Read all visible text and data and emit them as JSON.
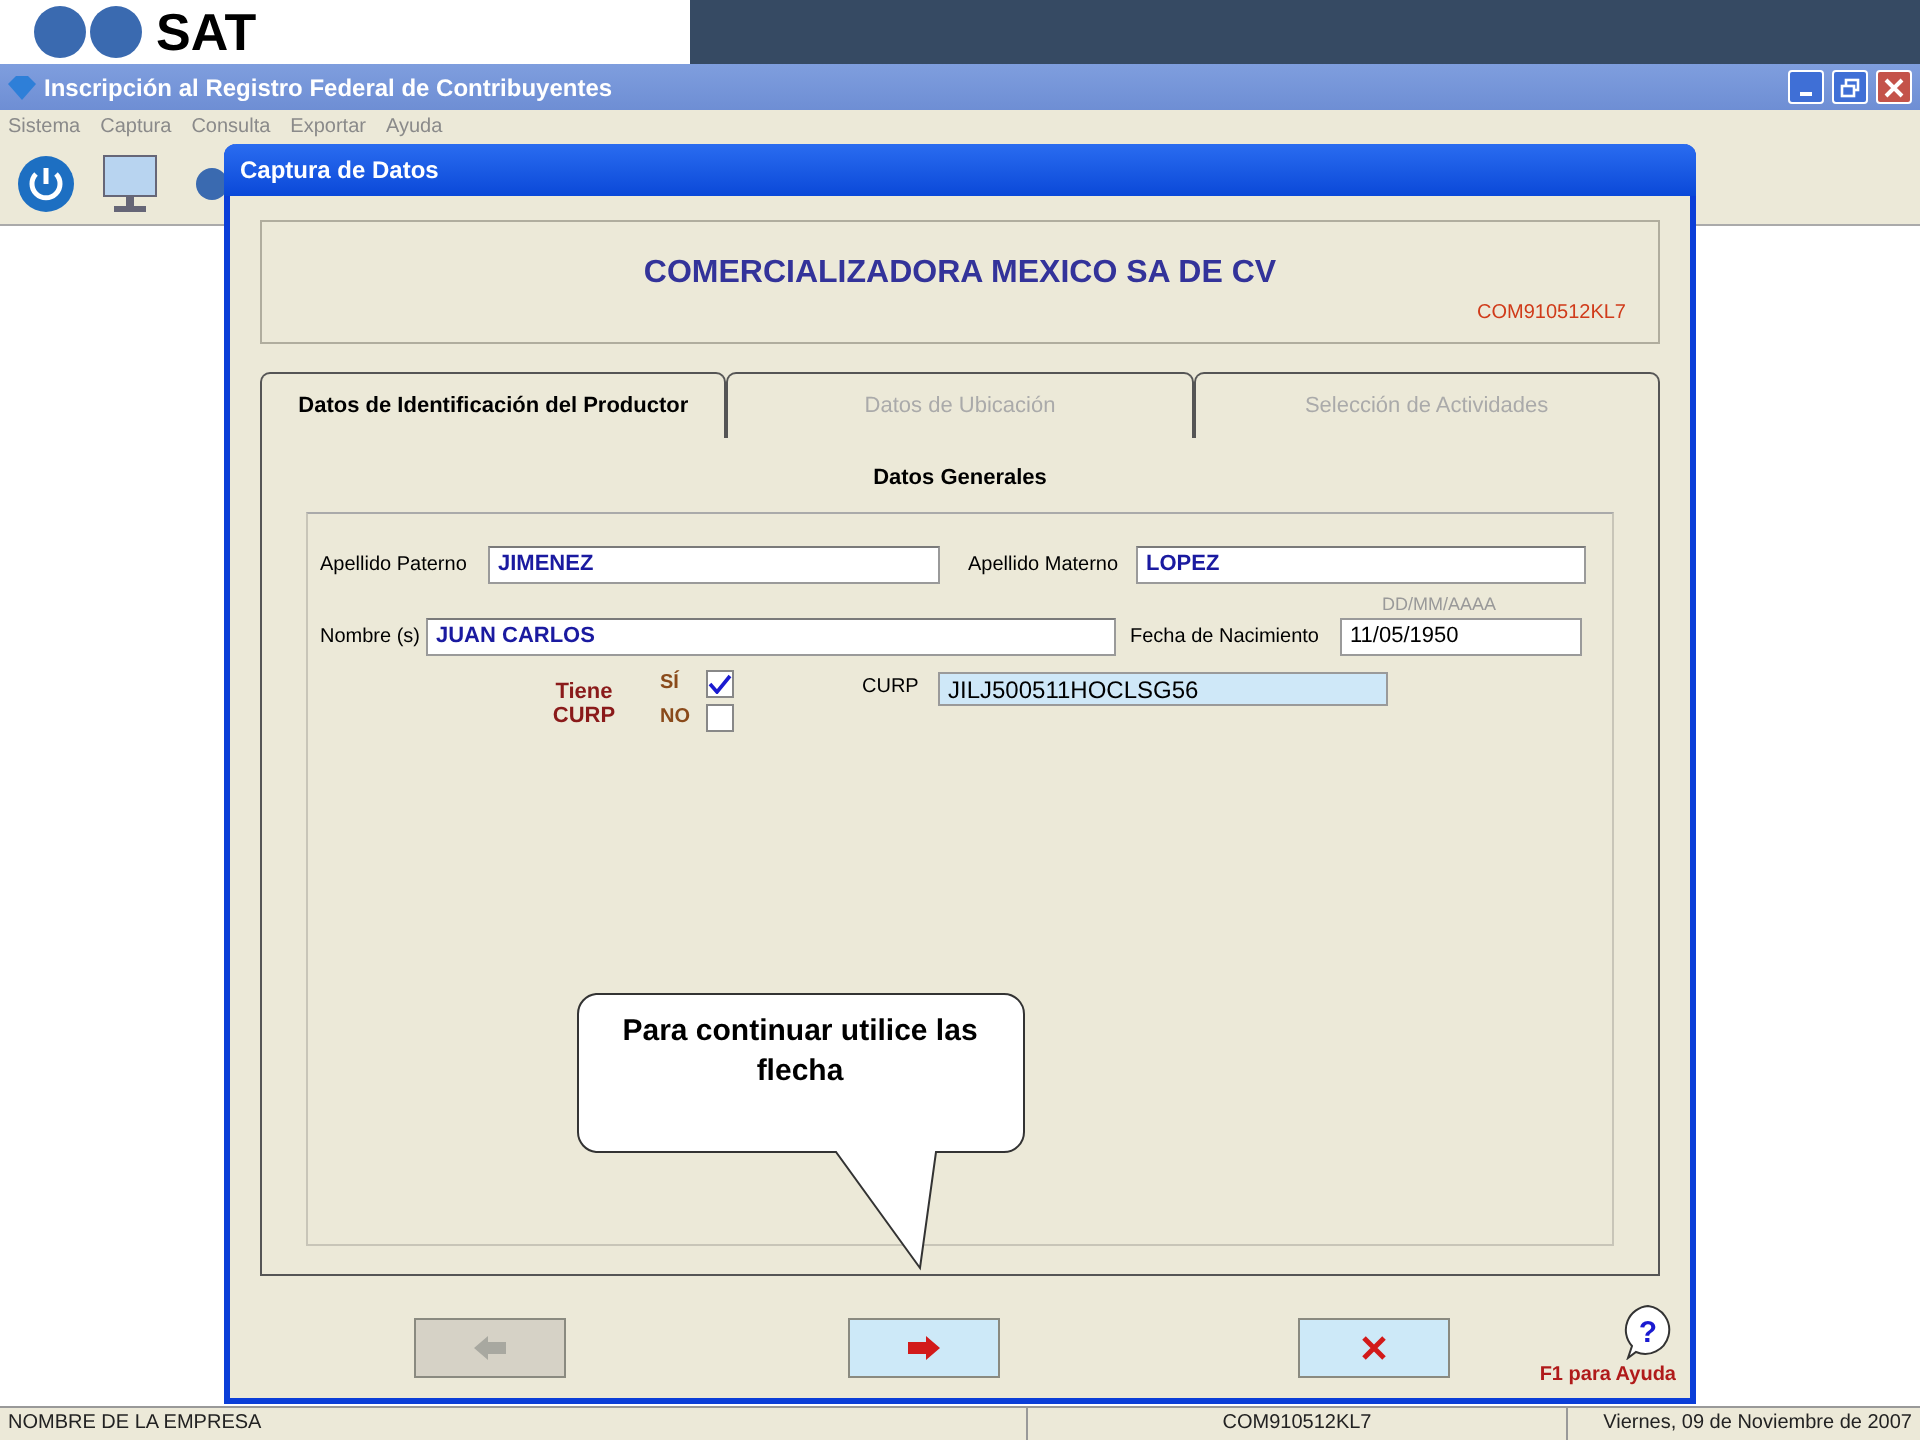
{
  "banner": {
    "logo_text": "SAT"
  },
  "window": {
    "title": "Inscripción al Registro Federal de Contribuyentes"
  },
  "menu": [
    "Sistema",
    "Captura",
    "Consulta",
    "Exportar",
    "Ayuda"
  ],
  "dialog": {
    "title": "Captura de Datos",
    "company": {
      "name": "COMERCIALIZADORA MEXICO SA DE CV",
      "rfc": "COM910512KL7"
    },
    "tabs": [
      {
        "label": "Datos de Identificación del Productor",
        "selected": true
      },
      {
        "label": "Datos de Ubicación",
        "selected": false
      },
      {
        "label": "Selección de Actividades",
        "selected": false
      }
    ],
    "section_title": "Datos Generales",
    "fields": {
      "apellido_paterno": {
        "label": "Apellido Paterno",
        "value": "JIMENEZ"
      },
      "apellido_materno": {
        "label": "Apellido Materno",
        "value": "LOPEZ"
      },
      "nombre": {
        "label": "Nombre (s)",
        "value": "JUAN CARLOS"
      },
      "fecha": {
        "label": "Fecha de Nacimiento",
        "hint": "DD/MM/AAAA",
        "value": "11/05/1950"
      },
      "curp": {
        "label": "CURP",
        "value": "JILJ500511HOCLSG56"
      }
    },
    "tiene_curp": {
      "label": "Tiene CURP",
      "options": [
        {
          "label": "SÍ",
          "checked": true
        },
        {
          "label": "NO",
          "checked": false
        }
      ]
    },
    "callout": "Para continuar utilice las flecha",
    "buttons": [
      {
        "kind": "back",
        "disabled": true
      },
      {
        "kind": "next",
        "disabled": false
      },
      {
        "kind": "cancel",
        "disabled": false
      }
    ],
    "help_mark": "?",
    "help": "F1 para Ayuda"
  },
  "status_bar": [
    "NOMBRE DE LA EMPRESA",
    "COM910512KL7",
    "Viernes, 09 de Noviembre de 2007"
  ]
}
